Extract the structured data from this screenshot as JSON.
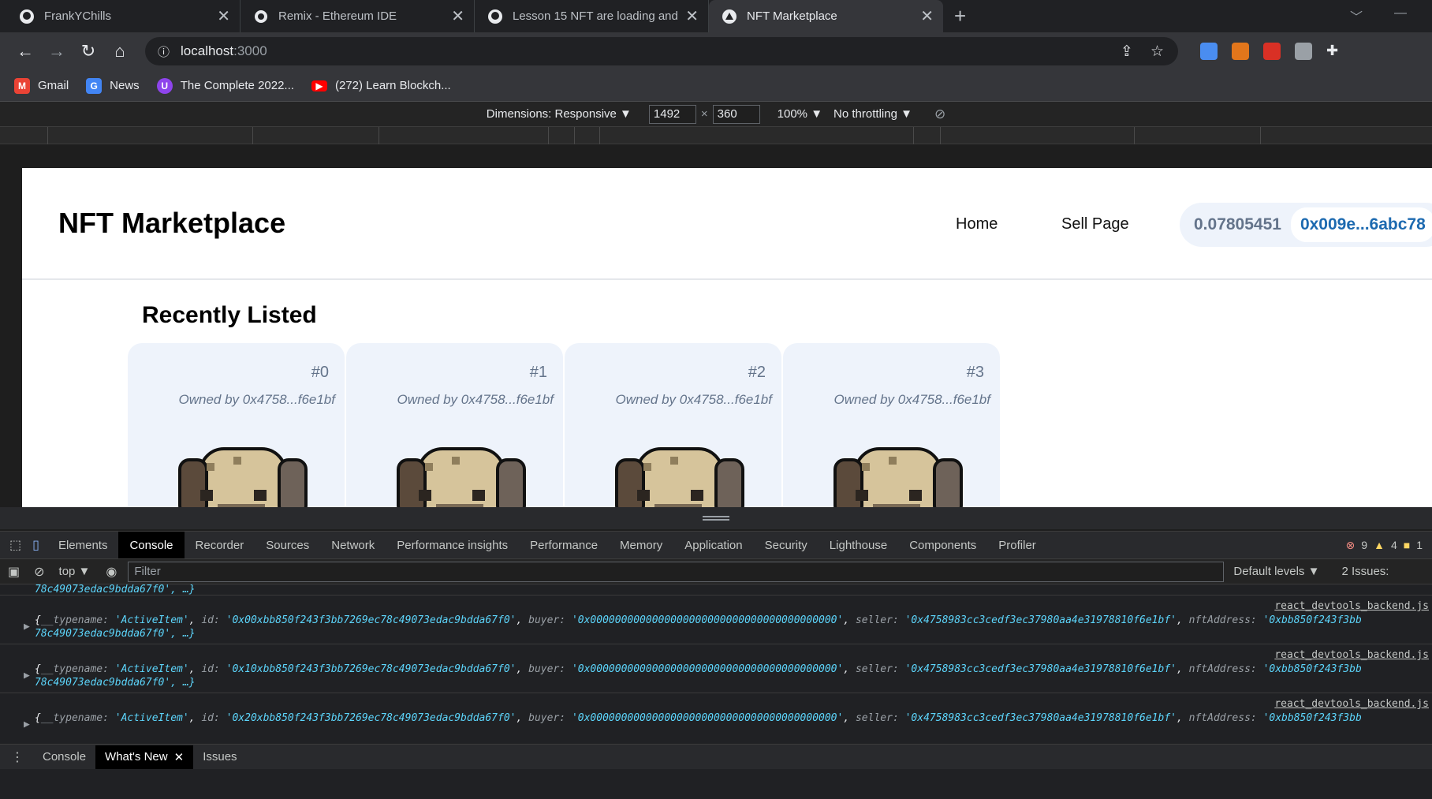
{
  "browser": {
    "tabs": [
      {
        "title": "FrankYChills",
        "icon": "github-icon"
      },
      {
        "title": "Remix - Ethereum IDE",
        "icon": "remix-icon"
      },
      {
        "title": "Lesson 15 NFT are loading and a",
        "icon": "github-icon"
      },
      {
        "title": "NFT Marketplace",
        "icon": "vercel-icon"
      }
    ],
    "url_host": "localhost",
    "url_port": ":3000",
    "bookmarks": [
      {
        "label": "Gmail",
        "icon": "gmail-icon"
      },
      {
        "label": "News",
        "icon": "news-icon"
      },
      {
        "label": "The Complete 2022...",
        "icon": "udemy-icon"
      },
      {
        "label": "(272) Learn Blockch...",
        "icon": "youtube-icon"
      }
    ]
  },
  "device": {
    "dimensions_label": "Dimensions: Responsive ▼",
    "width": "1492",
    "times": "×",
    "height": "360",
    "zoom": "100% ▼",
    "throttling": "No throttling ▼"
  },
  "app": {
    "title": "NFT Marketplace",
    "nav": [
      "Home",
      "Sell Page"
    ],
    "balance": "0.07805451",
    "address": "0x009e...6abc78",
    "section_title": "Recently Listed",
    "cards": [
      {
        "token": "#0",
        "owner": "Owned by 0x4758...f6e1bf"
      },
      {
        "token": "#1",
        "owner": "Owned by 0x4758...f6e1bf"
      },
      {
        "token": "#2",
        "owner": "Owned by 0x4758...f6e1bf"
      },
      {
        "token": "#3",
        "owner": "Owned by 0x4758...f6e1bf"
      }
    ]
  },
  "devtools": {
    "tabs": [
      "Elements",
      "Console",
      "Recorder",
      "Sources",
      "Network",
      "Performance insights",
      "Performance",
      "Memory",
      "Application",
      "Security",
      "Lighthouse",
      "Components",
      "Profiler"
    ],
    "active_tab": "Console",
    "errors": "9",
    "warnings": "4",
    "issues_badge": "1",
    "context": "top ▼",
    "filter_placeholder": "Filter",
    "levels": "Default levels ▼",
    "issues_label": "2 Issues:",
    "first_tail": "78c49073edac9bdda67f0', …}",
    "source": "react_devtools_backend.js",
    "logs": [
      {
        "typename": "'ActiveItem'",
        "id": "'0x00xbb850f243f3bb7269ec78c49073edac9bdda67f0'",
        "buyer": "'0x0000000000000000000000000000000000000000'",
        "seller": "'0x4758983cc3cedf3ec37980aa4e31978810f6e1bf'",
        "nftAddress": "'0xbb850f243f3bb",
        "tail": "78c49073edac9bdda67f0', …}"
      },
      {
        "typename": "'ActiveItem'",
        "id": "'0x10xbb850f243f3bb7269ec78c49073edac9bdda67f0'",
        "buyer": "'0x0000000000000000000000000000000000000000'",
        "seller": "'0x4758983cc3cedf3ec37980aa4e31978810f6e1bf'",
        "nftAddress": "'0xbb850f243f3bb",
        "tail": "78c49073edac9bdda67f0', …}"
      },
      {
        "typename": "'ActiveItem'",
        "id": "'0x20xbb850f243f3bb7269ec78c49073edac9bdda67f0'",
        "buyer": "'0x0000000000000000000000000000000000000000'",
        "seller": "'0x4758983cc3cedf3ec37980aa4e31978810f6e1bf'",
        "nftAddress": "'0xbb850f243f3bb",
        "tail": ""
      }
    ],
    "drawer_tabs": [
      "Console",
      "What's New",
      "Issues"
    ],
    "drawer_active": "What's New"
  }
}
